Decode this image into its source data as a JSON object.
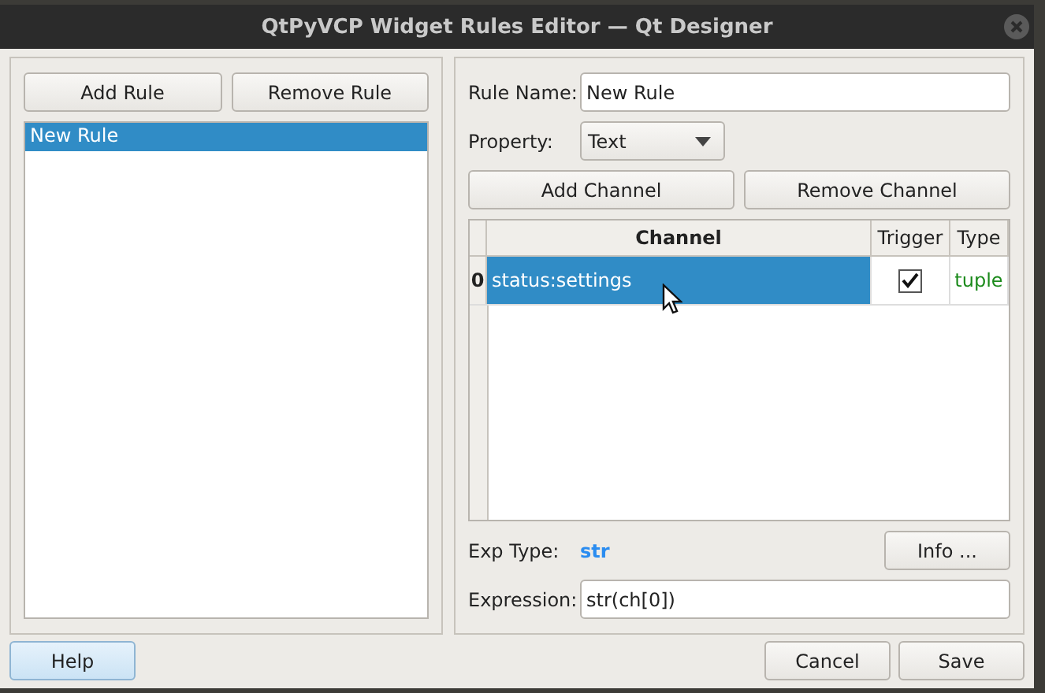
{
  "window": {
    "title": "QtPyVCP Widget Rules Editor — Qt Designer"
  },
  "rules_panel": {
    "buttons": [
      "Add Rule",
      "Remove Rule"
    ],
    "rules": [
      {
        "label": "New Rule",
        "selected": true
      }
    ]
  },
  "rule_panel": {
    "rule_name": {
      "label": "Rule Name:",
      "value": "New Rule"
    },
    "property": {
      "label": "Property:",
      "value": "Text"
    },
    "buttons": [
      "Add Channel",
      "Remove Channel"
    ],
    "table": {
      "columns": [
        "Channel",
        "Trigger",
        "Type"
      ],
      "rows": [
        {
          "index": "0",
          "channel": "status:settings",
          "trigger": true,
          "type": "tuple",
          "selected": true
        }
      ]
    },
    "exp_type": {
      "label": "Exp Type:",
      "value": "str"
    },
    "info_button": "Info ...",
    "expression": {
      "label": "Expression:",
      "value": "str(ch[0])"
    }
  },
  "footer": {
    "help": "Help",
    "buttons": [
      "Cancel",
      "Save"
    ]
  }
}
